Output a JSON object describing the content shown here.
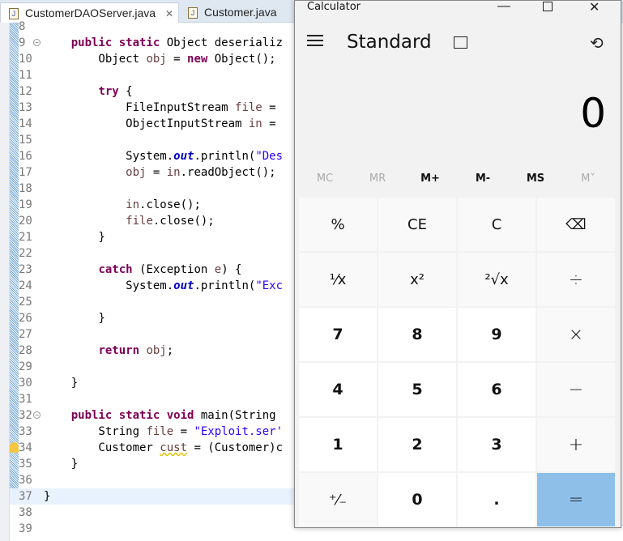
{
  "editor": {
    "tabs": [
      {
        "label": "CustomerDAOServer.java",
        "active": true
      },
      {
        "label": "Customer.java",
        "active": false
      }
    ],
    "lines": [
      {
        "n": "8",
        "html": ""
      },
      {
        "n": "9",
        "fold": true,
        "html": "    <span class='kw'>public static</span> Object deserializ"
      },
      {
        "n": "10",
        "html": "        Object <span class='var'>obj</span> = <span class='kw'>new</span> Object();"
      },
      {
        "n": "11",
        "html": ""
      },
      {
        "n": "12",
        "html": "        <span class='kw'>try</span> {"
      },
      {
        "n": "13",
        "html": "            FileInputStream <span class='var'>file</span> ="
      },
      {
        "n": "14",
        "html": "            ObjectInputStream <span class='var'>in</span> ="
      },
      {
        "n": "15",
        "html": ""
      },
      {
        "n": "16",
        "html": "            System.<span class='fd'>out</span>.println(<span class='st'>\"Des</span>"
      },
      {
        "n": "17",
        "html": "            <span class='var'>obj</span> = <span class='var'>in</span>.readObject();"
      },
      {
        "n": "18",
        "html": ""
      },
      {
        "n": "19",
        "html": "            <span class='var'>in</span>.close();"
      },
      {
        "n": "20",
        "html": "            <span class='var'>file</span>.close();"
      },
      {
        "n": "21",
        "html": "        }"
      },
      {
        "n": "22",
        "html": ""
      },
      {
        "n": "23",
        "html": "        <span class='kw'>catch</span> (Exception <span class='var'>e</span>) {"
      },
      {
        "n": "24",
        "html": "            System.<span class='fd'>out</span>.println(<span class='st'>\"Exc</span>"
      },
      {
        "n": "25",
        "html": ""
      },
      {
        "n": "26",
        "html": "        }"
      },
      {
        "n": "27",
        "html": ""
      },
      {
        "n": "28",
        "html": "        <span class='kw'>return</span> <span class='var'>obj</span>;"
      },
      {
        "n": "29",
        "html": ""
      },
      {
        "n": "30",
        "html": "    }"
      },
      {
        "n": "31",
        "html": ""
      },
      {
        "n": "32",
        "fold": true,
        "html": "    <span class='kw'>public static void</span> main(String"
      },
      {
        "n": "33",
        "html": "        String <span class='var'>file</span> = <span class='st'>\"Exploit.ser'</span>"
      },
      {
        "n": "34",
        "warn": true,
        "html": "        Customer <span class='var squig'>cust</span> = (Customer)c"
      },
      {
        "n": "35",
        "html": "    }"
      },
      {
        "n": "36",
        "html": ""
      },
      {
        "n": "37",
        "cur": true,
        "html": "}"
      },
      {
        "n": "38",
        "html": ""
      },
      {
        "n": "39",
        "html": ""
      }
    ]
  },
  "calculator": {
    "title": "Calculator",
    "mode": "Standard",
    "display": "0",
    "memory": [
      {
        "label": "MC",
        "enabled": false
      },
      {
        "label": "MR",
        "enabled": false
      },
      {
        "label": "M+",
        "enabled": true
      },
      {
        "label": "M-",
        "enabled": true
      },
      {
        "label": "MS",
        "enabled": true
      },
      {
        "label": "M˅",
        "enabled": false
      }
    ],
    "keys": [
      {
        "label": "%",
        "name": "percent"
      },
      {
        "label": "CE",
        "name": "clear-entry"
      },
      {
        "label": "C",
        "name": "clear"
      },
      {
        "label": "⌫",
        "name": "backspace"
      },
      {
        "label": "¹⁄x",
        "name": "reciprocal"
      },
      {
        "label": "x²",
        "name": "square"
      },
      {
        "label": "²√x",
        "name": "square-root"
      },
      {
        "label": "÷",
        "name": "divide",
        "op": true
      },
      {
        "label": "7",
        "name": "digit-7",
        "num": true
      },
      {
        "label": "8",
        "name": "digit-8",
        "num": true
      },
      {
        "label": "9",
        "name": "digit-9",
        "num": true
      },
      {
        "label": "×",
        "name": "multiply",
        "op": true
      },
      {
        "label": "4",
        "name": "digit-4",
        "num": true
      },
      {
        "label": "5",
        "name": "digit-5",
        "num": true
      },
      {
        "label": "6",
        "name": "digit-6",
        "num": true
      },
      {
        "label": "−",
        "name": "subtract",
        "op": true
      },
      {
        "label": "1",
        "name": "digit-1",
        "num": true
      },
      {
        "label": "2",
        "name": "digit-2",
        "num": true
      },
      {
        "label": "3",
        "name": "digit-3",
        "num": true
      },
      {
        "label": "+",
        "name": "add",
        "op": true
      },
      {
        "label": "⁺⁄₋",
        "name": "negate"
      },
      {
        "label": "0",
        "name": "digit-0",
        "num": true
      },
      {
        "label": ".",
        "name": "decimal",
        "num": true
      },
      {
        "label": "=",
        "name": "equals",
        "op": true,
        "eq": true
      }
    ],
    "accent": "#8dbfe9"
  }
}
